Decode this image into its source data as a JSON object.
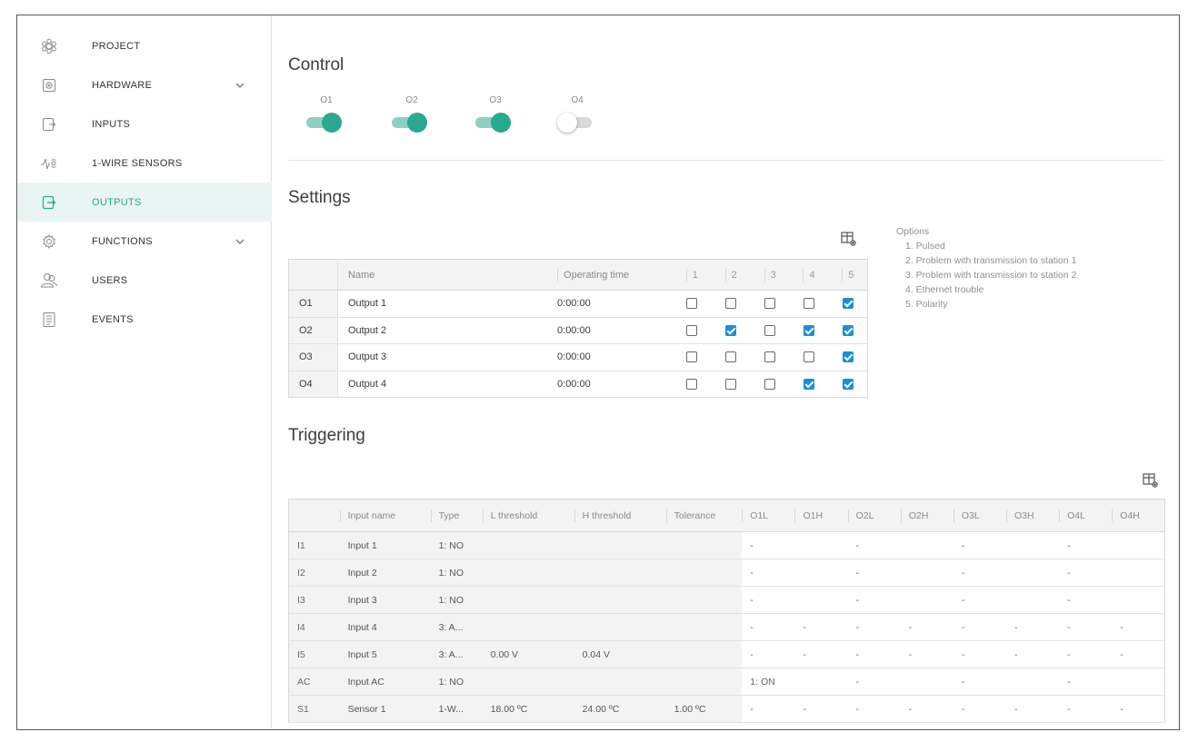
{
  "sidebar": {
    "items": [
      {
        "label": "PROJECT",
        "icon": "project-icon"
      },
      {
        "label": "HARDWARE",
        "icon": "hardware-icon",
        "expandable": true
      },
      {
        "label": "INPUTS",
        "icon": "inputs-icon"
      },
      {
        "label": "1-WIRE SENSORS",
        "icon": "sensor-icon"
      },
      {
        "label": "OUTPUTS",
        "icon": "outputs-icon",
        "active": true
      },
      {
        "label": "FUNCTIONS",
        "icon": "functions-icon",
        "expandable": true
      },
      {
        "label": "USERS",
        "icon": "users-icon"
      },
      {
        "label": "EVENTS",
        "icon": "events-icon"
      }
    ]
  },
  "control": {
    "title": "Control",
    "switches": [
      {
        "label": "O1",
        "on": true
      },
      {
        "label": "O2",
        "on": true
      },
      {
        "label": "O3",
        "on": true
      },
      {
        "label": "O4",
        "on": false
      }
    ]
  },
  "settings": {
    "title": "Settings",
    "headers": {
      "name": "Name",
      "time": "Operating time",
      "opts": [
        "1",
        "2",
        "3",
        "4",
        "5"
      ]
    },
    "rows": [
      {
        "id": "O1",
        "name": "Output 1",
        "time": "0:00:00",
        "opts": [
          false,
          false,
          false,
          false,
          true
        ]
      },
      {
        "id": "O2",
        "name": "Output 2",
        "time": "0:00:00",
        "opts": [
          false,
          true,
          false,
          true,
          true
        ]
      },
      {
        "id": "O3",
        "name": "Output 3",
        "time": "0:00:00",
        "opts": [
          false,
          false,
          false,
          false,
          true
        ]
      },
      {
        "id": "O4",
        "name": "Output 4",
        "time": "0:00:00",
        "opts": [
          false,
          false,
          false,
          true,
          true
        ]
      }
    ],
    "options_title": "Options",
    "options": [
      "1. Pulsed",
      "2. Problem with transmission to station 1",
      "3. Problem with transmission to station 2",
      "4. Ethernet trouble",
      "5. Polarity"
    ]
  },
  "triggering": {
    "title": "Triggering",
    "headers": [
      "",
      "Input name",
      "Type",
      "L threshold",
      "H threshold",
      "Tolerance",
      "O1L",
      "O1H",
      "O2L",
      "O2H",
      "O3L",
      "O3H",
      "O4L",
      "O4H"
    ],
    "rows": [
      [
        "I1",
        "Input 1",
        "1: NO",
        "",
        "",
        "",
        "-",
        "",
        "-",
        "",
        "-",
        "",
        "-",
        ""
      ],
      [
        "I2",
        "Input 2",
        "1: NO",
        "",
        "",
        "",
        "-",
        "",
        "-",
        "",
        "-",
        "",
        "-",
        ""
      ],
      [
        "I3",
        "Input 3",
        "1: NO",
        "",
        "",
        "",
        "-",
        "",
        "-",
        "",
        "-",
        "",
        "-",
        ""
      ],
      [
        "I4",
        "Input 4",
        "3: A...",
        "",
        "",
        "",
        "-",
        "-",
        "-",
        "-",
        "-",
        "-",
        "-",
        "-"
      ],
      [
        "I5",
        "Input 5",
        "3: A...",
        "0.00 V",
        "0.04 V",
        "",
        "-",
        "-",
        "-",
        "-",
        "-",
        "-",
        "-",
        "-"
      ],
      [
        "AC",
        "Input AC",
        "1: NO",
        "",
        "",
        "",
        "1: ON",
        "",
        "-",
        "",
        "-",
        "",
        "-",
        ""
      ],
      [
        "S1",
        "Sensor 1",
        "1-W...",
        "18.00 ºC",
        "24.00 ºC",
        "1.00 ºC",
        "-",
        "-",
        "-",
        "-",
        "-",
        "-",
        "-",
        "-"
      ]
    ]
  }
}
